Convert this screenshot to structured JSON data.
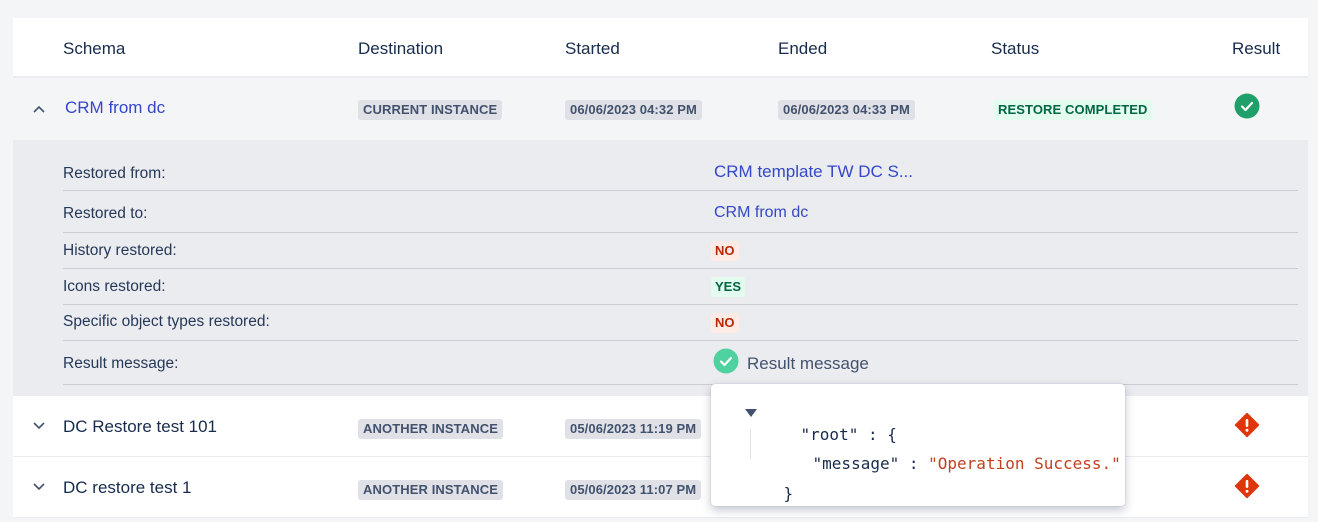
{
  "columns": {
    "schema": "Schema",
    "destination": "Destination",
    "started": "Started",
    "ended": "Ended",
    "status": "Status",
    "result": "Result"
  },
  "rows": [
    {
      "name": "CRM from dc",
      "destination": "CURRENT INSTANCE",
      "started": "06/06/2023 04:32 PM",
      "ended": "06/06/2023 04:33 PM",
      "status": "RESTORE COMPLETED",
      "result": "success",
      "expanded": true
    },
    {
      "name": "DC Restore test 101",
      "destination": "ANOTHER INSTANCE",
      "started": "05/06/2023 11:19 PM",
      "result": "error",
      "expanded": false
    },
    {
      "name": "DC restore test 1",
      "destination": "ANOTHER INSTANCE",
      "started": "05/06/2023 11:07 PM",
      "result": "error",
      "expanded": false
    }
  ],
  "details": {
    "restored_from_label": "Restored from:",
    "restored_from_value": "CRM template TW DC S...",
    "restored_to_label": "Restored to:",
    "restored_to_value": "CRM from dc",
    "history_label": "History restored:",
    "history_value": "NO",
    "icons_label": "Icons restored:",
    "icons_value": "YES",
    "specific_label": "Specific object types restored:",
    "specific_value": "NO",
    "result_message_label": "Result message:",
    "result_message_value": "Result message"
  },
  "json_popup": {
    "root_key": "\"root\"",
    "colon": " : ",
    "open_brace": "{",
    "message_key": "\"message\"",
    "message_value": "\"Operation Success.\"",
    "close_brace": "}"
  },
  "colors": {
    "success": "#36b37e",
    "error": "#de350b",
    "link": "#3447c7"
  },
  "icons": {
    "chevron_up": "chevron-up-icon",
    "chevron_down": "chevron-down-icon",
    "check_circle": "check-circle-icon",
    "error_diamond": "error-diamond-icon"
  }
}
